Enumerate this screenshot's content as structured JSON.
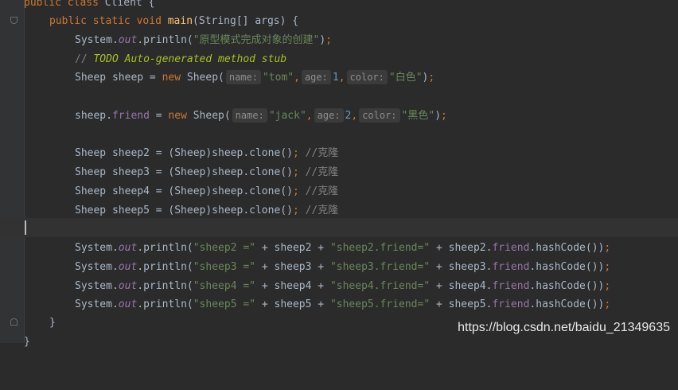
{
  "lines": {
    "l0": [
      "public",
      " ",
      "class",
      " Client {"
    ],
    "l1": [
      "public",
      " ",
      "static",
      " ",
      "void",
      " ",
      "main",
      "(String[] args) {"
    ],
    "l2": [
      "System.",
      "out",
      ".println(",
      "\"原型模式完成对象的创建\"",
      ")",
      ";"
    ],
    "l3": [
      "// ",
      "TODO Auto-generated method stub"
    ],
    "l4": [
      "Sheep sheep = ",
      "new",
      " Sheep(",
      "name:",
      "\"tom\"",
      ",",
      "age:",
      "1",
      ",",
      "color:",
      "\"白色\"",
      ")",
      ";"
    ],
    "l5": [
      "sheep.",
      "friend",
      " = ",
      "new",
      " Sheep(",
      "name:",
      "\"jack\"",
      ",",
      "age:",
      "2",
      ",",
      "color:",
      "\"黑色\"",
      ")",
      ";"
    ],
    "l6": [
      "Sheep sheep2 = (Sheep)sheep.clone()",
      ";",
      " //克隆"
    ],
    "l7": [
      "Sheep sheep3 = (Sheep)sheep.clone()",
      ";",
      " //克隆"
    ],
    "l8": [
      "Sheep sheep4 = (Sheep)sheep.clone()",
      ";",
      " //克隆"
    ],
    "l9": [
      "Sheep sheep5 = (Sheep)sheep.clone()",
      ";",
      " //克隆"
    ],
    "l10": [
      "System.",
      "out",
      ".println(",
      "\"sheep2 =\"",
      " + sheep2 + ",
      "\"sheep2.friend=\"",
      " + sheep2.",
      "friend",
      ".hashCode())",
      ";"
    ],
    "l11": [
      "System.",
      "out",
      ".println(",
      "\"sheep3 =\"",
      " + sheep3 + ",
      "\"sheep3.friend=\"",
      " + sheep3.",
      "friend",
      ".hashCode())",
      ";"
    ],
    "l12": [
      "System.",
      "out",
      ".println(",
      "\"sheep4 =\"",
      " + sheep4 + ",
      "\"sheep4.friend=\"",
      " + sheep4.",
      "friend",
      ".hashCode())",
      ";"
    ],
    "l13": [
      "System.",
      "out",
      ".println(",
      "\"sheep5 =\"",
      " + sheep5 + ",
      "\"sheep5.friend=\"",
      " + sheep5.",
      "friend",
      ".hashCode())",
      ";"
    ],
    "l14": [
      "}"
    ],
    "l15": [
      "}"
    ]
  },
  "watermark": "https://blog.csdn.net/baidu_21349635",
  "colors": {
    "background": "#2b2b2b",
    "keyword": "#cc7832",
    "method": "#ffc66d",
    "string": "#6a8759",
    "field": "#9876aa",
    "number": "#6897bb",
    "comment": "#808080",
    "todo": "#a8c023"
  }
}
